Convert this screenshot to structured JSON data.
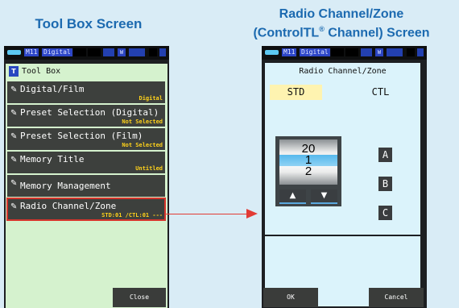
{
  "captions": {
    "left": "Tool Box Screen",
    "right_line1": "Radio Channel/Zone",
    "right_line2_pre": "(ControlTL",
    "right_line2_sup": "®",
    "right_line2_post": " Channel) Screen"
  },
  "statusbar": {
    "mode": "M11",
    "medium": "Digital",
    "icon": "W"
  },
  "toolbox": {
    "title_icon": "T",
    "title": "Tool Box",
    "items": [
      {
        "label": "Digital/Film",
        "value": "Digital"
      },
      {
        "label": "Preset Selection (Digital)",
        "value": "Not Selected"
      },
      {
        "label": "Preset Selection (Film)",
        "value": "Not Selected"
      },
      {
        "label": "Memory Title",
        "value": "Untitled"
      },
      {
        "label": "Memory Management",
        "value": ""
      },
      {
        "label": "Radio Channel/Zone",
        "value": "STD:01 /CTL:01 ---"
      }
    ],
    "close_label": "Close"
  },
  "radio": {
    "title": "Radio Channel/Zone",
    "tab_std": "STD",
    "tab_ctl": "CTL",
    "drum": {
      "prev": "20",
      "current": "1",
      "next": "2"
    },
    "zones": [
      "A",
      "B",
      "C"
    ],
    "ok_label": "OK",
    "cancel_label": "Cancel"
  },
  "colors": {
    "caption": "#1c6ab0",
    "panel_green": "#d5f2ce",
    "panel_blue": "#dbf3fb",
    "std_tab": "#fef3b0",
    "value_yellow": "#ffd21a",
    "highlight_red": "#d6342c",
    "drum_selected": "#56b8ec"
  },
  "icons": {
    "menu": "wrench-icon",
    "up": "triangle-up-icon",
    "down": "triangle-down-icon"
  }
}
